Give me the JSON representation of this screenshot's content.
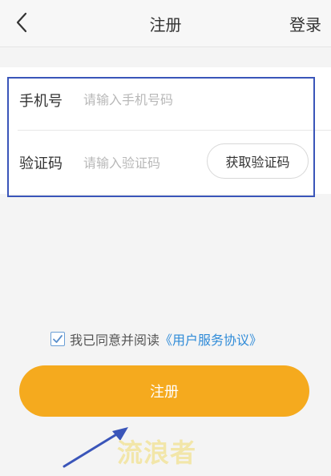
{
  "header": {
    "title": "注册",
    "login_label": "登录",
    "back_icon": "chevron-left-icon"
  },
  "form": {
    "phone_label": "手机号",
    "phone_placeholder": "请输入手机号码",
    "phone_value": "",
    "code_label": "验证码",
    "code_placeholder": "请输入验证码",
    "code_value": "",
    "get_code_label": "获取验证码"
  },
  "agreement": {
    "checked": true,
    "text": "我已同意并阅读",
    "link_text": "《用户服务协议》"
  },
  "register_button_label": "注册",
  "watermark_text": "流浪者",
  "colors": {
    "accent": "#f5aa1e",
    "link": "#2f8bd8",
    "highlight": "#3a55b9"
  }
}
